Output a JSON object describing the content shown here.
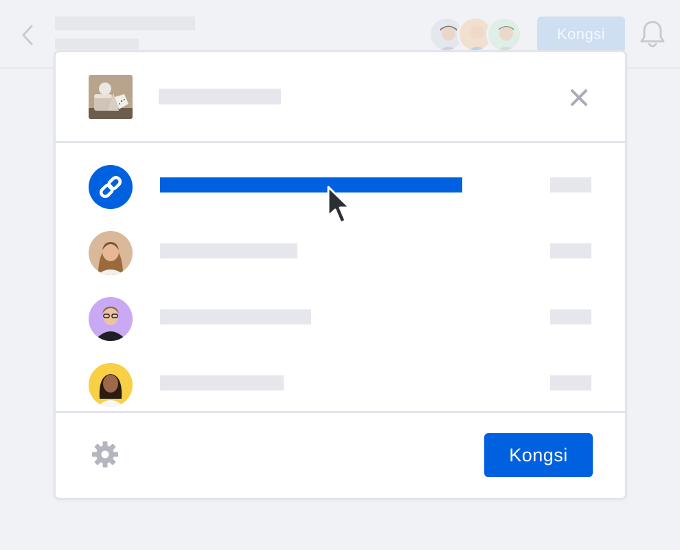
{
  "appbar": {
    "back_icon": "chevron-left-icon",
    "share_label": "Kongsi",
    "notification_icon": "bell-icon"
  },
  "share_dialog": {
    "close_icon": "close-icon",
    "rows": [
      {
        "kind": "link",
        "icon": "link-icon",
        "accent": "#0061e0"
      },
      {
        "kind": "person",
        "avatar_bg": "#d9b99a"
      },
      {
        "kind": "person",
        "avatar_bg": "#c9a9f4"
      },
      {
        "kind": "person",
        "avatar_bg": "#f7d046"
      }
    ],
    "footer": {
      "settings_icon": "gear-icon",
      "share_label": "Kongsi"
    }
  },
  "colors": {
    "accent": "#0061e0",
    "placeholder": "#e6e7ec",
    "background": "#f1f2f6"
  }
}
